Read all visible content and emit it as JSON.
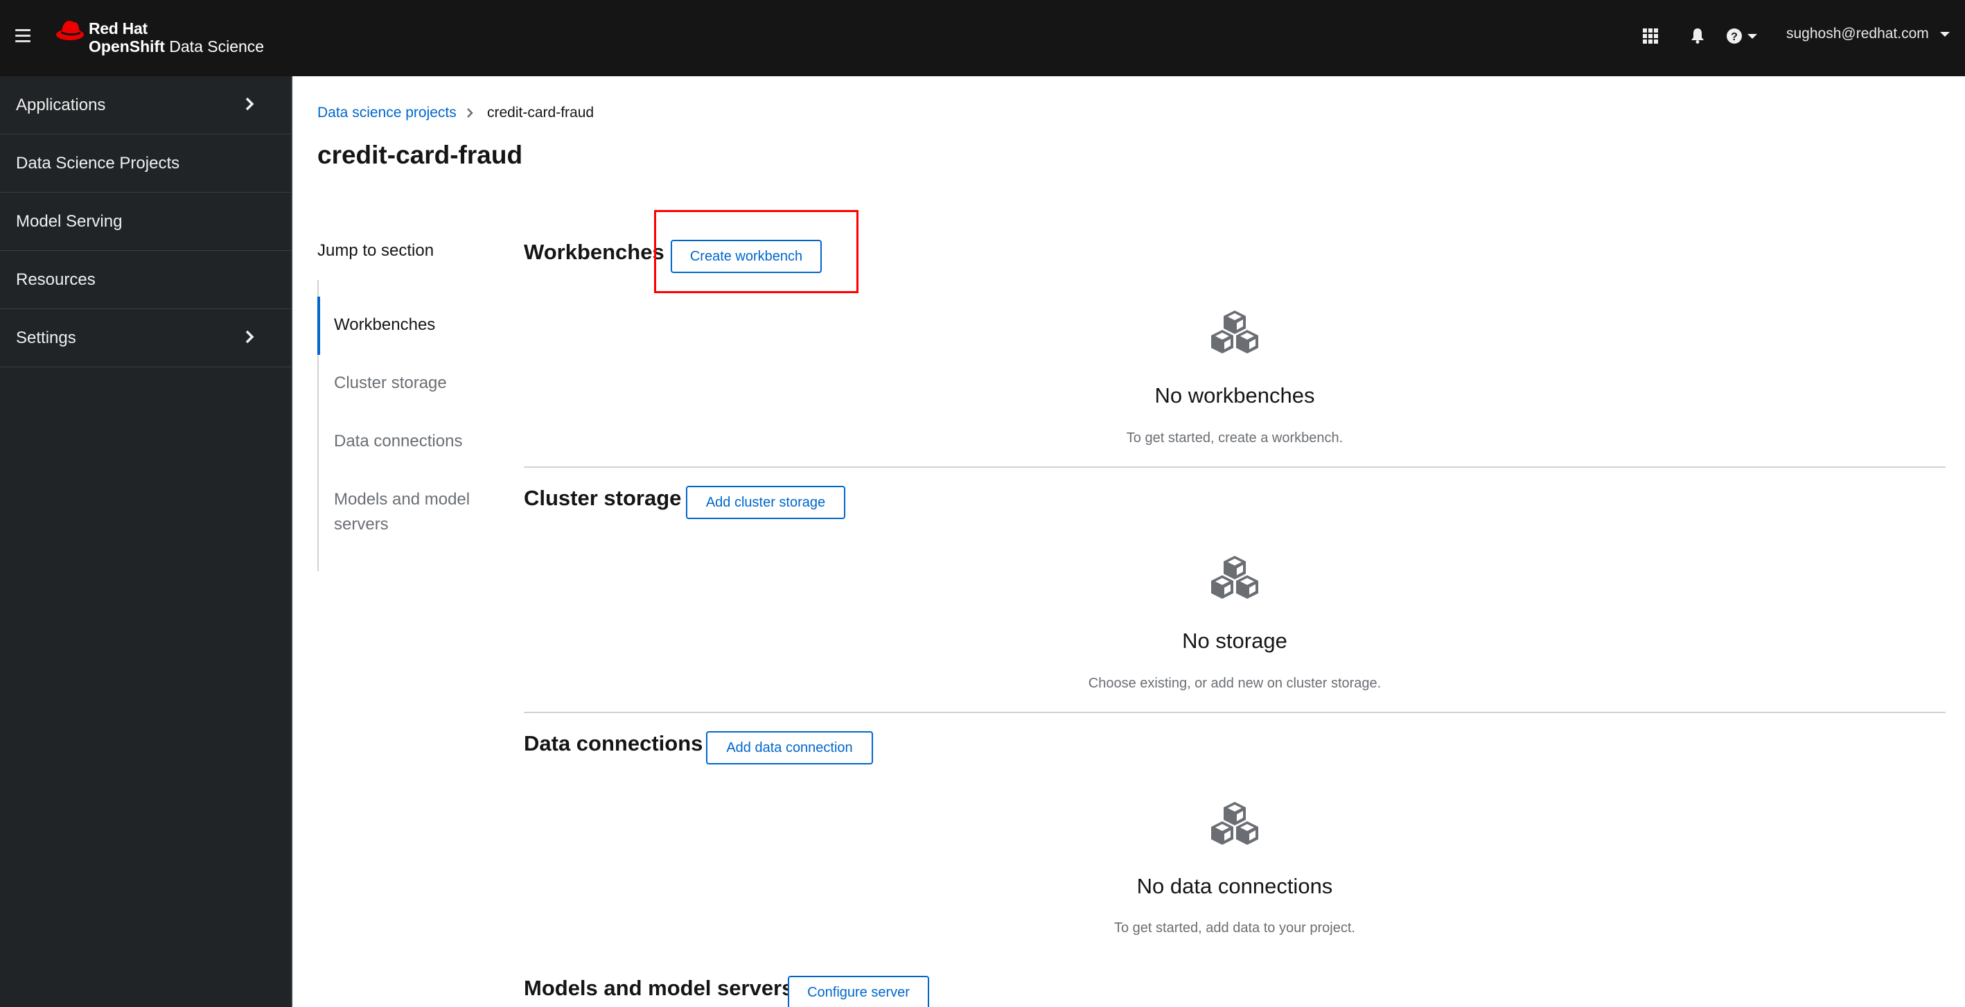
{
  "header": {
    "brand_line1": "Red Hat",
    "brand_line2_bold": "OpenShift",
    "brand_line2_rest": " Data Science",
    "user": "sughosh@redhat.com",
    "icons": [
      "hamburger-icon",
      "app-launcher-icon",
      "bell-icon",
      "help-icon"
    ]
  },
  "sidebar": {
    "items": [
      {
        "label": "Applications",
        "expandable": true
      },
      {
        "label": "Data Science Projects",
        "expandable": false
      },
      {
        "label": "Model Serving",
        "expandable": false
      },
      {
        "label": "Resources",
        "expandable": false
      },
      {
        "label": "Settings",
        "expandable": true
      }
    ]
  },
  "breadcrumb": {
    "parent": "Data science projects",
    "current": "credit-card-fraud"
  },
  "page": {
    "title": "credit-card-fraud"
  },
  "jump": {
    "title": "Jump to section",
    "items": [
      {
        "label": "Workbenches",
        "active": true
      },
      {
        "label": "Cluster storage",
        "active": false
      },
      {
        "label": "Data connections",
        "active": false
      },
      {
        "label": "Models and model servers",
        "active": false
      }
    ]
  },
  "sections": [
    {
      "title": "Workbenches",
      "button": "Create workbench",
      "empty_title": "No workbenches",
      "empty_body": "To get started, create a workbench.",
      "highlighted": true
    },
    {
      "title": "Cluster storage",
      "button": "Add cluster storage",
      "empty_title": "No storage",
      "empty_body": "Choose existing, or add new on cluster storage."
    },
    {
      "title": "Data connections",
      "button": "Add data connection",
      "empty_title": "No data connections",
      "empty_body": "To get started, add data to your project."
    },
    {
      "title": "Models and model servers",
      "button": "Configure server"
    }
  ],
  "colors": {
    "masthead": "#151515",
    "sidebar": "#212427",
    "link": "#0066cc",
    "highlight": "#ff0000",
    "brand_red": "#ee0000"
  }
}
